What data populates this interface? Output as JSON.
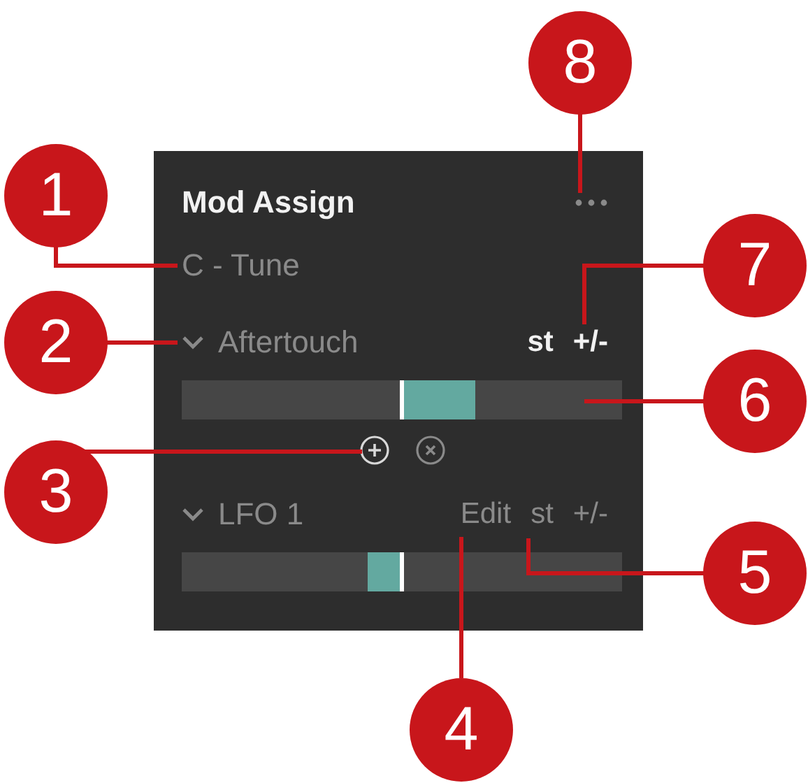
{
  "panel": {
    "title": "Mod Assign",
    "target": "C - Tune",
    "sources": [
      {
        "name": "Aftertouch",
        "unit": "st",
        "polarity": "+/-",
        "active": true
      },
      {
        "name": "LFO 1",
        "edit": "Edit",
        "unit": "st",
        "polarity": "+/-",
        "active": false
      }
    ]
  },
  "callouts": [
    {
      "label": "8"
    },
    {
      "label": "1"
    },
    {
      "label": "7"
    },
    {
      "label": "2"
    },
    {
      "label": "6"
    },
    {
      "label": "3"
    },
    {
      "label": "5"
    },
    {
      "label": "4"
    }
  ]
}
